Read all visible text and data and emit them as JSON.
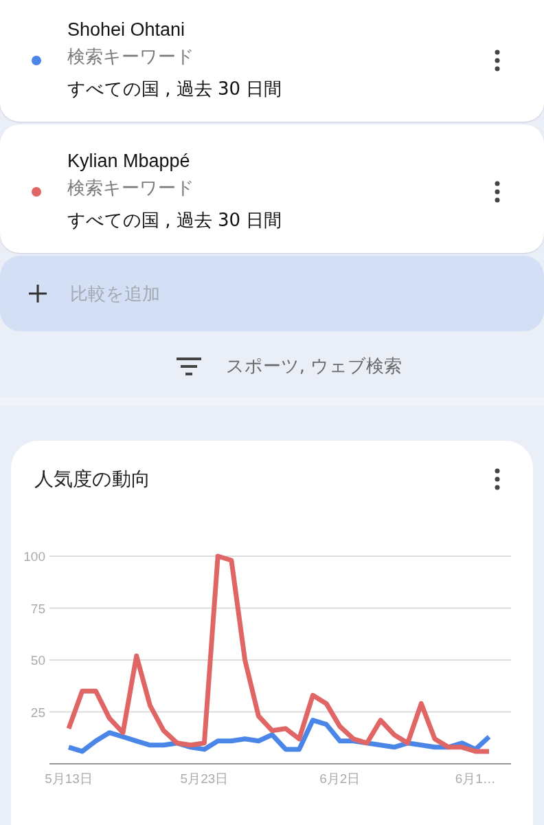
{
  "terms": [
    {
      "name": "Shohei Ohtani",
      "type": "検索キーワード",
      "scope": "すべての国 , 過去 30 日間",
      "color": "#4a86e8"
    },
    {
      "name": "Kylian Mbappé",
      "type": "検索キーワード",
      "scope": "すべての国 , 過去 30 日間",
      "color": "#e06666"
    }
  ],
  "add_compare": {
    "placeholder": "比較を追加"
  },
  "filter": {
    "label": "スポーツ, ウェブ検索"
  },
  "trend_card": {
    "title": "人気度の動向",
    "chart_data": {
      "type": "line",
      "categories": [
        "5月13日",
        null,
        null,
        null,
        null,
        null,
        null,
        null,
        null,
        null,
        "5月23日",
        null,
        null,
        null,
        null,
        null,
        null,
        null,
        null,
        null,
        "6月2日",
        null,
        null,
        null,
        null,
        null,
        null,
        null,
        null,
        null,
        "6月1…",
        null
      ],
      "series": [
        {
          "color": "#4a86e8",
          "values": [
            8,
            6,
            11,
            15,
            13,
            11,
            9,
            9,
            10,
            8,
            7,
            11,
            11,
            12,
            11,
            14,
            7,
            7,
            21,
            19,
            11,
            11,
            10,
            9,
            8,
            10,
            9,
            8,
            8,
            10,
            7,
            13
          ]
        },
        {
          "color": "#e06666",
          "values": [
            17,
            35,
            35,
            22,
            15,
            52,
            28,
            16,
            10,
            9,
            10,
            100,
            98,
            50,
            23,
            16,
            17,
            12,
            33,
            29,
            18,
            12,
            10,
            21,
            14,
            10,
            29,
            12,
            8,
            8,
            6,
            6
          ]
        }
      ],
      "ylim": [
        0,
        100
      ],
      "yticks": [
        25,
        50,
        75,
        100
      ],
      "grid": true
    }
  }
}
